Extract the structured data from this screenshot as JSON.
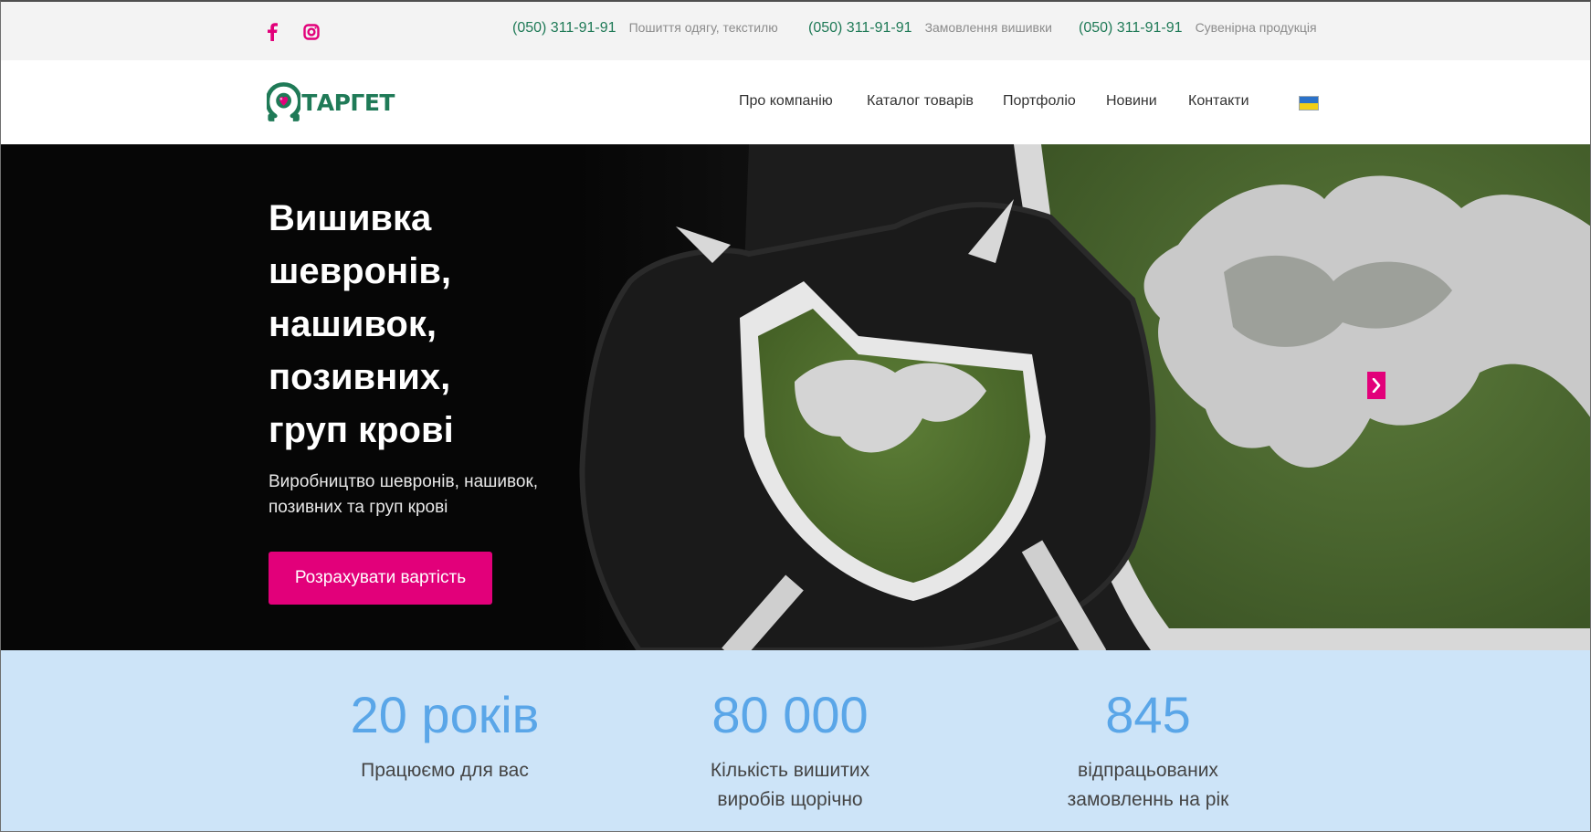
{
  "topbar": {
    "social": [
      {
        "icon": "facebook-icon"
      },
      {
        "icon": "instagram-icon"
      }
    ],
    "contacts": [
      {
        "phone": "(050) 311-91-91",
        "desc": "Пошиття одягу, текстилю"
      },
      {
        "phone": "(050) 311-91-91",
        "desc": "Замовлення вишивки"
      },
      {
        "phone": "(050) 311-91-91",
        "desc": "Сувенірна продукція"
      }
    ]
  },
  "header": {
    "logo_text": "ТАРГЕТ",
    "nav": [
      "Про компанію",
      "Каталог товарів",
      "Портфоліо",
      "Новини",
      "Контакти"
    ],
    "language_icon": "ukraine-flag-icon"
  },
  "hero": {
    "title_lines": [
      "Вишивка",
      "шевронів,",
      "нашивок,",
      "позивних,",
      "груп крові"
    ],
    "subtitle_lines": [
      "Виробництво шевронів, нашивок,",
      "позивних та груп крові"
    ],
    "cta_label": "Розрахувати вартість",
    "next_icon": "chevron-right-icon"
  },
  "stats": [
    {
      "value": "20 років",
      "label_lines": [
        "Працюємо для вас"
      ]
    },
    {
      "value": "80 000",
      "label_lines": [
        "Кількість вишитих",
        "виробів щорічно"
      ]
    },
    {
      "value": "845",
      "label_lines": [
        "відпрацьованих",
        "замовленнь на рік"
      ]
    }
  ],
  "colors": {
    "brand_green": "#1f7a57",
    "brand_magenta": "#e2007a",
    "stats_bg": "#cde4f8",
    "stats_number": "#5aa6e8"
  }
}
